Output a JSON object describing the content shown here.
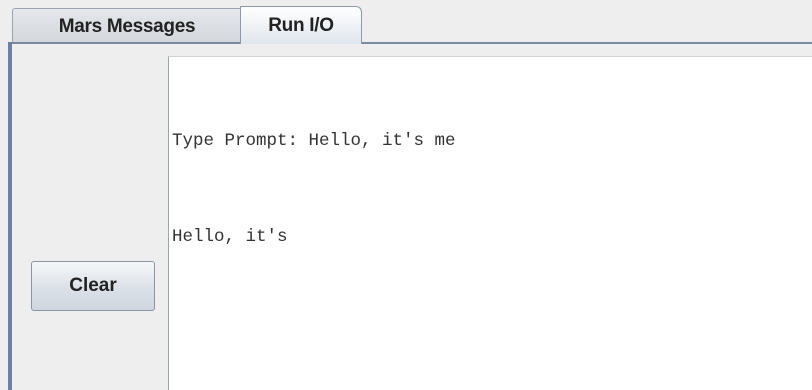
{
  "tabs": [
    {
      "label": "Mars Messages",
      "selected": false
    },
    {
      "label": "Run I/O",
      "selected": true
    }
  ],
  "side_panel": {
    "clear_label": "Clear"
  },
  "console": {
    "lines": [
      "Type Prompt: Hello, it's me",
      "Hello, it's"
    ]
  }
}
